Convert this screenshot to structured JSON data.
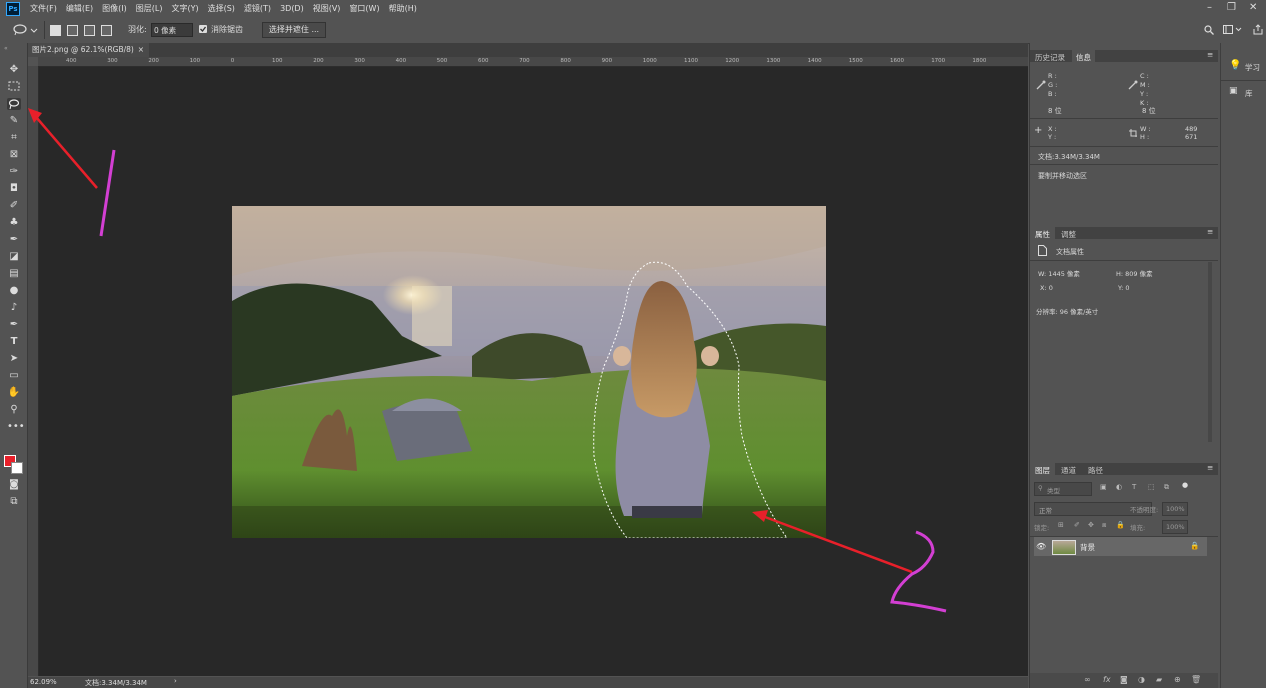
{
  "app": {
    "logo": "Ps",
    "menu": [
      "文件(F)",
      "编辑(E)",
      "图像(I)",
      "图层(L)",
      "文字(Y)",
      "选择(S)",
      "滤镜(T)",
      "3D(D)",
      "视图(V)",
      "窗口(W)",
      "帮助(H)"
    ],
    "window_controls": [
      "–",
      "❐",
      "✕"
    ]
  },
  "options_bar": {
    "feather_label": "羽化:",
    "feather_value": "0 像素",
    "antialias_label": "消除锯齿",
    "select_mask_button": "选择并遮住 ..."
  },
  "document_tab": {
    "title": "图片2.png @ 62.1%(RGB/8)",
    "close": "×"
  },
  "ruler_top_ticks": [
    "400",
    "300",
    "200",
    "100",
    "0",
    "100",
    "200",
    "300",
    "400",
    "500",
    "600",
    "700",
    "800",
    "900",
    "1000",
    "1100",
    "1200",
    "1300",
    "1400",
    "1500",
    "1600",
    "1700",
    "1800"
  ],
  "status_bar": {
    "zoom": "62.09%",
    "doc_size": "文档:3.34M/3.34M",
    "arrow": "›"
  },
  "annotations": {
    "marker_1": "1",
    "marker_2": "2",
    "colors": {
      "arrow": "#e8202a",
      "marker": "#d33fd3"
    }
  },
  "info_panel": {
    "tabs": [
      "历史记录",
      "信息"
    ],
    "rgb_labels": "R :\nG :\nB :",
    "cmyk_labels": "C :\nM :\nY :\nK :",
    "bit_left": "8 位",
    "bit_right": "8 位",
    "xy_labels": "X :\nY :",
    "wh_labels": "W :\nH :",
    "w_value": "489",
    "h_value": "671",
    "doc_info": "文档:3.34M/3.34M",
    "hint": "要制并移动选区"
  },
  "properties_panel": {
    "tabs": [
      "属性",
      "调整"
    ],
    "section_title": "文档属性",
    "w": "W:  1445 像素",
    "h": "H:  809 像素",
    "x": "X:  0",
    "y": "Y:  0",
    "resolution": "分辨率: 96 像素/英寸"
  },
  "layers_panel": {
    "tabs": [
      "图层",
      "通道",
      "路径"
    ],
    "filter_label": "类型",
    "blend_mode": "正常",
    "opacity_label": "不透明度:",
    "opacity_value": "100%",
    "lock_label": "锁定:",
    "fill_label": "填充:",
    "fill_value": "100%",
    "layer_name": "背景",
    "footer_icons": [
      "link-icon",
      "fx-icon",
      "mask-icon",
      "adjustment-icon",
      "group-icon",
      "new-layer-icon",
      "trash-icon"
    ],
    "footer_fx": "fx"
  },
  "side_panel": {
    "learn_label": "学习",
    "library_label": "库"
  }
}
